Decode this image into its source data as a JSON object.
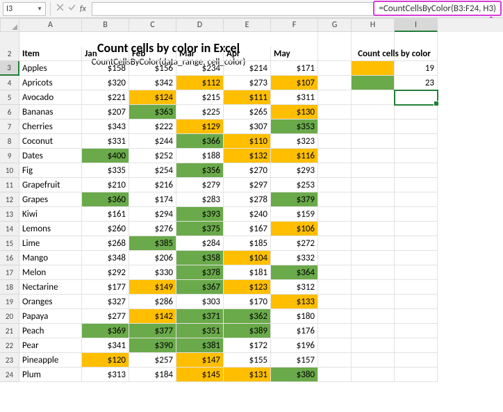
{
  "namebox": "I3",
  "formula": "=CountCellsByColor(B3:F24, H3)",
  "col_letters": [
    "A",
    "B",
    "C",
    "D",
    "E",
    "F",
    "G",
    "H",
    "I"
  ],
  "row_numbers": [
    "1",
    "2",
    "3",
    "4",
    "5",
    "6",
    "7",
    "8",
    "9",
    "10",
    "11",
    "12",
    "13",
    "14",
    "15",
    "16",
    "17",
    "18",
    "19",
    "20",
    "21",
    "22",
    "23",
    "24"
  ],
  "title": "Count cells by color in Excel",
  "subtitle": "CountCellsByColor(data_range, cell_color)",
  "headers": {
    "item": "Item",
    "jan": "Jan",
    "feb": "Feb",
    "mar": "Mar",
    "apr": "Apr",
    "may": "May"
  },
  "side_header": "Count cells by color",
  "side_rows": [
    {
      "swatch": "c-orange",
      "value": "19"
    },
    {
      "swatch": "c-green",
      "value": "23"
    }
  ],
  "chart_data": {
    "type": "table",
    "columns": [
      "Item",
      "Jan",
      "Feb",
      "Mar",
      "Apr",
      "May"
    ],
    "rows": [
      {
        "item": "Apples",
        "vals": [
          {
            "v": "$158",
            "c": ""
          },
          {
            "v": "$156",
            "c": ""
          },
          {
            "v": "$234",
            "c": ""
          },
          {
            "v": "$214",
            "c": ""
          },
          {
            "v": "$171",
            "c": ""
          }
        ]
      },
      {
        "item": "Apricots",
        "vals": [
          {
            "v": "$320",
            "c": ""
          },
          {
            "v": "$342",
            "c": ""
          },
          {
            "v": "$112",
            "c": "c-orange"
          },
          {
            "v": "$273",
            "c": ""
          },
          {
            "v": "$107",
            "c": "c-orange"
          }
        ]
      },
      {
        "item": "Avocado",
        "vals": [
          {
            "v": "$221",
            "c": ""
          },
          {
            "v": "$124",
            "c": "c-orange"
          },
          {
            "v": "$215",
            "c": ""
          },
          {
            "v": "$111",
            "c": "c-orange"
          },
          {
            "v": "$311",
            "c": ""
          }
        ]
      },
      {
        "item": "Bananas",
        "vals": [
          {
            "v": "$207",
            "c": ""
          },
          {
            "v": "$363",
            "c": "c-green"
          },
          {
            "v": "$225",
            "c": ""
          },
          {
            "v": "$265",
            "c": ""
          },
          {
            "v": "$130",
            "c": "c-orange"
          }
        ]
      },
      {
        "item": "Cherries",
        "vals": [
          {
            "v": "$343",
            "c": ""
          },
          {
            "v": "$222",
            "c": ""
          },
          {
            "v": "$129",
            "c": "c-orange"
          },
          {
            "v": "$307",
            "c": ""
          },
          {
            "v": "$353",
            "c": "c-green"
          }
        ]
      },
      {
        "item": "Coconut",
        "vals": [
          {
            "v": "$331",
            "c": ""
          },
          {
            "v": "$244",
            "c": ""
          },
          {
            "v": "$366",
            "c": "c-green"
          },
          {
            "v": "$110",
            "c": "c-orange"
          },
          {
            "v": "$323",
            "c": ""
          }
        ]
      },
      {
        "item": "Dates",
        "vals": [
          {
            "v": "$400",
            "c": "c-green"
          },
          {
            "v": "$252",
            "c": ""
          },
          {
            "v": "$188",
            "c": ""
          },
          {
            "v": "$132",
            "c": "c-orange"
          },
          {
            "v": "$116",
            "c": "c-orange"
          }
        ]
      },
      {
        "item": "Fig",
        "vals": [
          {
            "v": "$335",
            "c": ""
          },
          {
            "v": "$254",
            "c": ""
          },
          {
            "v": "$356",
            "c": "c-green"
          },
          {
            "v": "$270",
            "c": ""
          },
          {
            "v": "$293",
            "c": ""
          }
        ]
      },
      {
        "item": "Grapefruit",
        "vals": [
          {
            "v": "$210",
            "c": ""
          },
          {
            "v": "$216",
            "c": ""
          },
          {
            "v": "$279",
            "c": ""
          },
          {
            "v": "$297",
            "c": ""
          },
          {
            "v": "$253",
            "c": ""
          }
        ]
      },
      {
        "item": "Grapes",
        "vals": [
          {
            "v": "$360",
            "c": "c-green"
          },
          {
            "v": "$174",
            "c": ""
          },
          {
            "v": "$283",
            "c": ""
          },
          {
            "v": "$278",
            "c": ""
          },
          {
            "v": "$379",
            "c": "c-green"
          }
        ]
      },
      {
        "item": "Kiwi",
        "vals": [
          {
            "v": "$161",
            "c": ""
          },
          {
            "v": "$294",
            "c": ""
          },
          {
            "v": "$393",
            "c": "c-green"
          },
          {
            "v": "$240",
            "c": ""
          },
          {
            "v": "$159",
            "c": ""
          }
        ]
      },
      {
        "item": "Lemons",
        "vals": [
          {
            "v": "$260",
            "c": ""
          },
          {
            "v": "$276",
            "c": ""
          },
          {
            "v": "$375",
            "c": "c-green"
          },
          {
            "v": "$167",
            "c": ""
          },
          {
            "v": "$106",
            "c": "c-orange"
          }
        ]
      },
      {
        "item": "Lime",
        "vals": [
          {
            "v": "$268",
            "c": ""
          },
          {
            "v": "$385",
            "c": "c-green"
          },
          {
            "v": "$284",
            "c": ""
          },
          {
            "v": "$185",
            "c": ""
          },
          {
            "v": "$272",
            "c": ""
          }
        ]
      },
      {
        "item": "Mango",
        "vals": [
          {
            "v": "$348",
            "c": ""
          },
          {
            "v": "$206",
            "c": ""
          },
          {
            "v": "$358",
            "c": "c-green"
          },
          {
            "v": "$104",
            "c": "c-orange"
          },
          {
            "v": "$332",
            "c": ""
          }
        ]
      },
      {
        "item": "Melon",
        "vals": [
          {
            "v": "$292",
            "c": ""
          },
          {
            "v": "$330",
            "c": ""
          },
          {
            "v": "$378",
            "c": "c-green"
          },
          {
            "v": "$181",
            "c": ""
          },
          {
            "v": "$364",
            "c": "c-green"
          }
        ]
      },
      {
        "item": "Nectarine",
        "vals": [
          {
            "v": "$177",
            "c": ""
          },
          {
            "v": "$149",
            "c": "c-orange"
          },
          {
            "v": "$367",
            "c": "c-green"
          },
          {
            "v": "$123",
            "c": "c-orange"
          },
          {
            "v": "$312",
            "c": ""
          }
        ]
      },
      {
        "item": "Oranges",
        "vals": [
          {
            "v": "$327",
            "c": ""
          },
          {
            "v": "$286",
            "c": ""
          },
          {
            "v": "$303",
            "c": ""
          },
          {
            "v": "$170",
            "c": ""
          },
          {
            "v": "$133",
            "c": "c-orange"
          }
        ]
      },
      {
        "item": "Papaya",
        "vals": [
          {
            "v": "$277",
            "c": ""
          },
          {
            "v": "$142",
            "c": "c-orange"
          },
          {
            "v": "$371",
            "c": "c-green"
          },
          {
            "v": "$362",
            "c": "c-green"
          },
          {
            "v": "$180",
            "c": ""
          }
        ]
      },
      {
        "item": "Peach",
        "vals": [
          {
            "v": "$369",
            "c": "c-green"
          },
          {
            "v": "$377",
            "c": "c-green"
          },
          {
            "v": "$351",
            "c": "c-green"
          },
          {
            "v": "$389",
            "c": "c-green"
          },
          {
            "v": "$176",
            "c": ""
          }
        ]
      },
      {
        "item": "Pear",
        "vals": [
          {
            "v": "$341",
            "c": ""
          },
          {
            "v": "$390",
            "c": "c-green"
          },
          {
            "v": "$381",
            "c": "c-green"
          },
          {
            "v": "$172",
            "c": ""
          },
          {
            "v": "$196",
            "c": ""
          }
        ]
      },
      {
        "item": "Pineapple",
        "vals": [
          {
            "v": "$120",
            "c": "c-orange"
          },
          {
            "v": "$257",
            "c": ""
          },
          {
            "v": "$147",
            "c": "c-orange"
          },
          {
            "v": "$155",
            "c": ""
          },
          {
            "v": "$157",
            "c": ""
          }
        ]
      },
      {
        "item": "Plum",
        "vals": [
          {
            "v": "$313",
            "c": ""
          },
          {
            "v": "$184",
            "c": ""
          },
          {
            "v": "$145",
            "c": "c-orange"
          },
          {
            "v": "$131",
            "c": "c-orange"
          },
          {
            "v": "$380",
            "c": "c-green"
          }
        ]
      }
    ]
  }
}
